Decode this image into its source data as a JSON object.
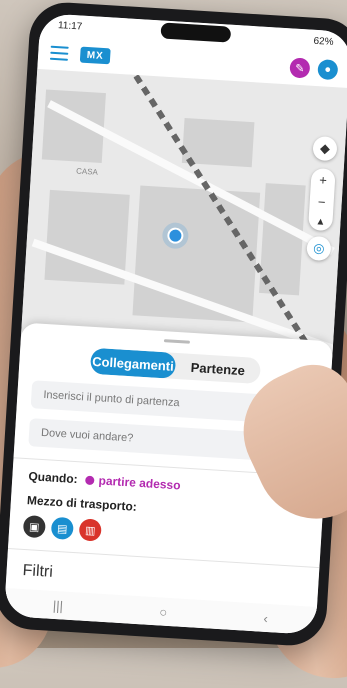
{
  "status": {
    "time": "11:17",
    "battery": "62%"
  },
  "appbar": {
    "logo_text": "MX"
  },
  "map": {
    "label": "CASA"
  },
  "tabs": [
    {
      "label": "Collegamenti",
      "active": true
    },
    {
      "label": "Partenze",
      "active": false
    }
  ],
  "origin": {
    "placeholder": "Inserisci il punto di partenza"
  },
  "destination": {
    "placeholder": "Dove vuoi andare?"
  },
  "when": {
    "label": "Quando:",
    "value": "partire adesso"
  },
  "transport": {
    "label": "Mezzo di trasporto:",
    "modes": [
      {
        "icon": "train-icon",
        "color": "#333333"
      },
      {
        "icon": "bus-icon",
        "color": "#1a8fd0"
      },
      {
        "icon": "cable-car-icon",
        "color": "#d9342b"
      }
    ]
  },
  "filters": {
    "label": "Filtri"
  },
  "colors": {
    "accent": "#1a8fd0",
    "when": "#b32bb0"
  }
}
